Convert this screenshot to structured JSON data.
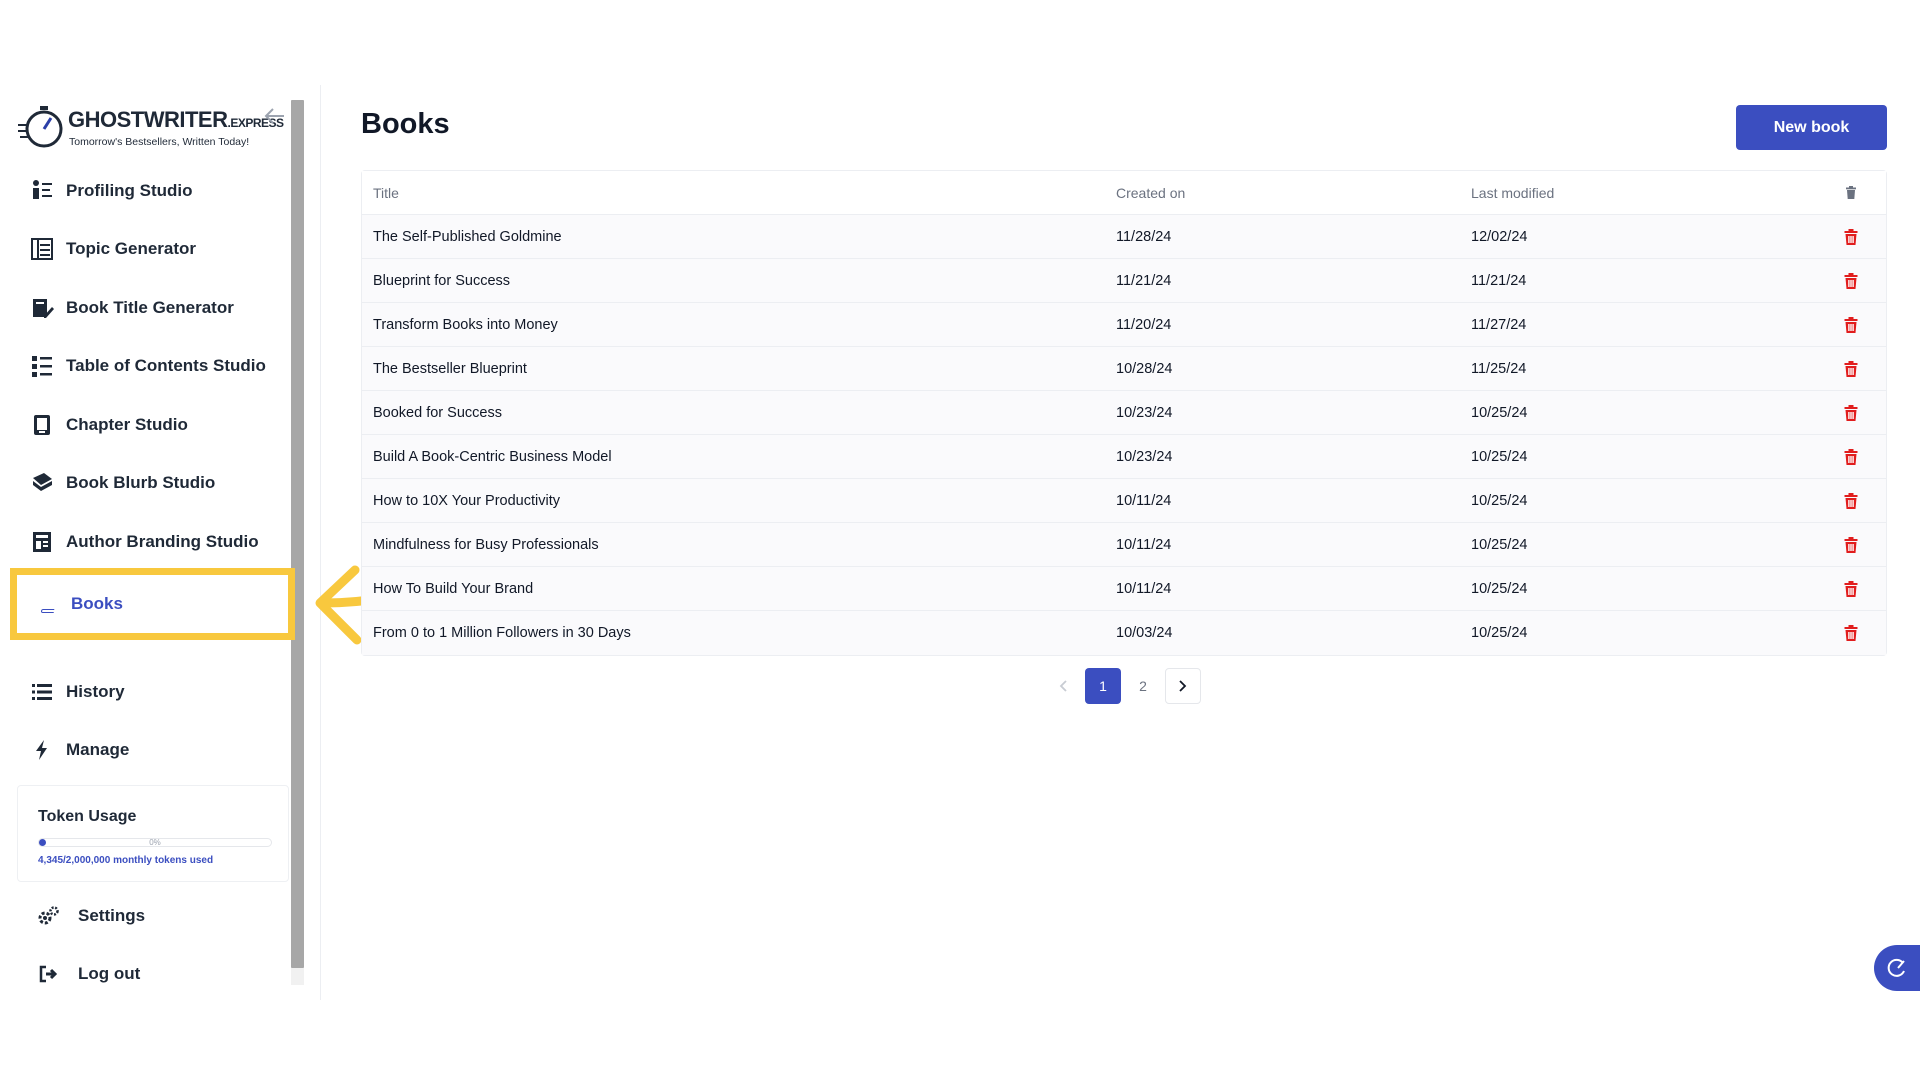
{
  "app": {
    "logo_main": "GHOSTWRITER",
    "logo_suffix": ".EXPRESS",
    "logo_tagline": "Tomorrow's Bestsellers, Written Today!"
  },
  "sidebar": {
    "items": [
      {
        "label": "Profiling Studio",
        "icon": "profiling-icon"
      },
      {
        "label": "Topic Generator",
        "icon": "topic-list-icon"
      },
      {
        "label": "Book Title Generator",
        "icon": "book-pen-icon"
      },
      {
        "label": "Table of Contents Studio",
        "icon": "contents-list-icon"
      },
      {
        "label": "Chapter Studio",
        "icon": "chapter-icon"
      },
      {
        "label": "Book Blurb Studio",
        "icon": "blurb-book-icon"
      },
      {
        "label": "Author Branding Studio",
        "icon": "branding-icon"
      },
      {
        "label": "Books",
        "icon": "book-icon",
        "active": true
      },
      {
        "label": "History",
        "icon": "list-icon"
      },
      {
        "label": "Manage",
        "icon": "bolt-icon"
      }
    ],
    "token_usage": {
      "title": "Token Usage",
      "percent_label": "0%",
      "fraction_used": 0.0022,
      "used_text": "4,345/2,000,000 monthly tokens used"
    },
    "settings_label": "Settings",
    "logout_label": "Log out"
  },
  "main": {
    "title": "Books",
    "new_book_label": "New book",
    "table": {
      "headers": {
        "title": "Title",
        "created": "Created on",
        "modified": "Last modified"
      },
      "rows": [
        {
          "title": "The Self-Published Goldmine",
          "created": "11/28/24",
          "modified": "12/02/24"
        },
        {
          "title": "Blueprint for Success",
          "created": "11/21/24",
          "modified": "11/21/24"
        },
        {
          "title": "Transform Books into Money",
          "created": "11/20/24",
          "modified": "11/27/24"
        },
        {
          "title": "The Bestseller Blueprint",
          "created": "10/28/24",
          "modified": "11/25/24"
        },
        {
          "title": "Booked for Success",
          "created": "10/23/24",
          "modified": "10/25/24"
        },
        {
          "title": "Build A Book-Centric Business Model",
          "created": "10/23/24",
          "modified": "10/25/24"
        },
        {
          "title": "How to 10X Your Productivity",
          "created": "10/11/24",
          "modified": "10/25/24"
        },
        {
          "title": "Mindfulness for Busy Professionals",
          "created": "10/11/24",
          "modified": "10/25/24"
        },
        {
          "title": "How To Build Your Brand",
          "created": "10/11/24",
          "modified": "10/25/24"
        },
        {
          "title": "From 0 to 1 Million Followers in 30 Days",
          "created": "10/03/24",
          "modified": "10/25/24"
        }
      ]
    },
    "pagination": {
      "pages": [
        "1",
        "2"
      ],
      "current": "1"
    }
  },
  "colors": {
    "accent": "#3b4ec0",
    "delete": "#e11d1d",
    "highlight": "#f8c83e"
  }
}
